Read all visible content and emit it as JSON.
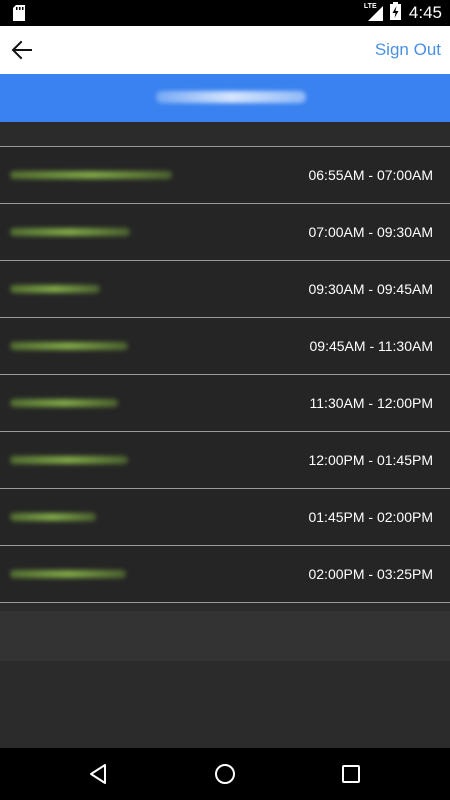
{
  "status_bar": {
    "time": "4:45",
    "network": "LTE",
    "icons": [
      "sd-card-icon",
      "signal-icon",
      "battery-charging-icon"
    ]
  },
  "app_bar": {
    "back_icon": "arrow-left-icon",
    "sign_out_label": "Sign Out"
  },
  "colors": {
    "accent_blue": "#3a82f0",
    "link_blue": "#4a90e2",
    "list_background": "#252525",
    "page_background": "#2b2b2b"
  },
  "schedule": {
    "items": [
      {
        "time": "06:55AM - 07:00AM"
      },
      {
        "time": "07:00AM - 09:30AM"
      },
      {
        "time": "09:30AM - 09:45AM"
      },
      {
        "time": "09:45AM - 11:30AM"
      },
      {
        "time": "11:30AM - 12:00PM"
      },
      {
        "time": "12:00PM - 01:45PM"
      },
      {
        "time": "01:45PM - 02:00PM"
      },
      {
        "time": "02:00PM - 03:25PM"
      }
    ]
  },
  "nav_bar": {
    "icons": [
      "back-triangle-icon",
      "home-circle-icon",
      "recents-square-icon"
    ]
  }
}
